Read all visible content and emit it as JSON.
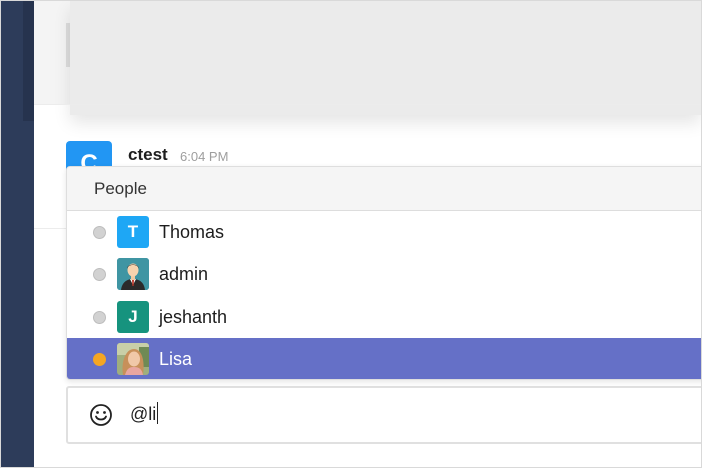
{
  "message": {
    "avatar_letter": "C",
    "user": "ctest",
    "time": "6:04 PM"
  },
  "mentions": {
    "header": "People",
    "items": [
      {
        "name": "Thomas",
        "avatar": "letter",
        "letter": "T",
        "avatar_color": "#1ea7f5",
        "status": "offline",
        "selected": false
      },
      {
        "name": "admin",
        "avatar": "person-icon",
        "avatar_color": "#3f95a3",
        "status": "offline",
        "selected": false
      },
      {
        "name": "jeshanth",
        "avatar": "letter",
        "letter": "J",
        "avatar_color": "#16937e",
        "status": "offline",
        "selected": false
      },
      {
        "name": "Lisa",
        "avatar": "photo",
        "avatar_color": "#9fae7e",
        "status": "away",
        "selected": true
      }
    ]
  },
  "composer": {
    "value": "@li",
    "emoji_icon": "smiley-icon"
  },
  "colors": {
    "selected_row": "#6570c7",
    "away_status": "#f5a623",
    "offline_status": "#d2d2d2",
    "sidebar": "#2d3c5a",
    "message_avatar": "#2296f3"
  }
}
